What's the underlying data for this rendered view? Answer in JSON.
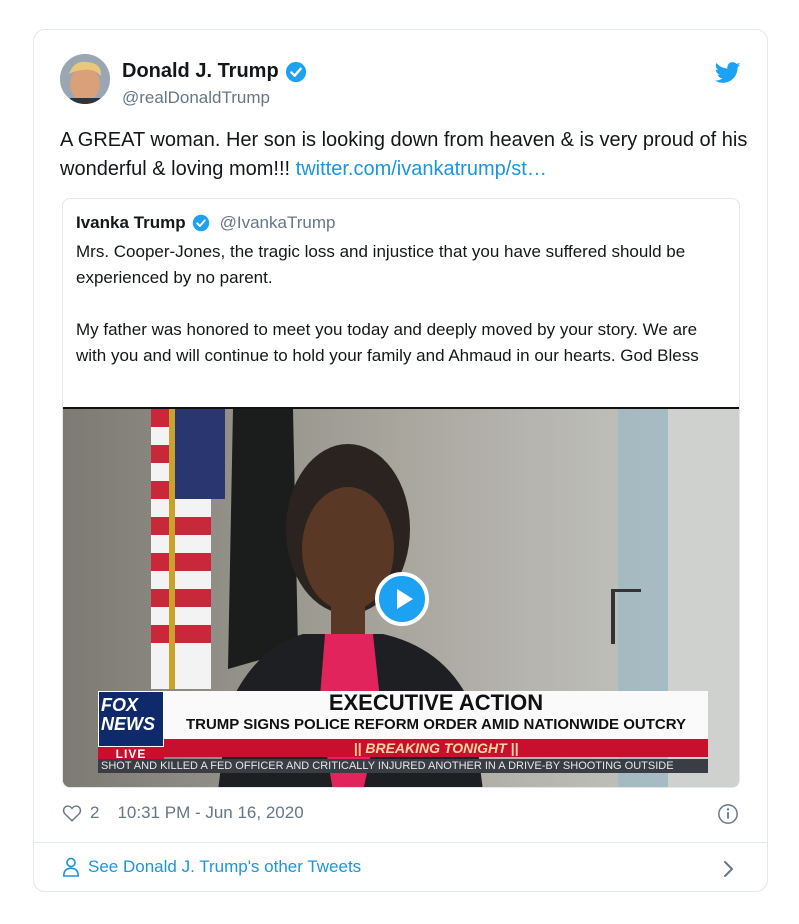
{
  "tweet": {
    "author_name": "Donald J. Trump",
    "author_handle": "@realDonaldTrump",
    "text": "A GREAT woman. Her son is looking down from heaven & is very proud of his wonderful & loving mom!!! ",
    "link_text": "twitter.com/ivankatrump/st…",
    "likes": "2",
    "timestamp": "10:31 PM - Jun 16, 2020"
  },
  "quoted_tweet": {
    "author_name": "Ivanka Trump",
    "author_handle": "@IvankaTrump",
    "paragraph_1": "Mrs. Cooper-Jones, the tragic loss and injustice that you have suffered should be experienced by no parent.",
    "paragraph_2": "My father was honored to meet you today and deeply moved by your story. We are with you and will continue to hold your family and Ahmaud in our hearts. God Bless"
  },
  "video": {
    "network_logo_line1": "FOX",
    "network_logo_line2": "NEWS",
    "live_label": "LIVE",
    "chyron_title": "EXECUTIVE ACTION",
    "chyron_subtitle": "TRUMP SIGNS POLICE REFORM ORDER AMID NATIONWIDE OUTCRY",
    "breaking_label": "|| BREAKING TONIGHT ||",
    "ticker_text": "SHOT AND KILLED A FED OFFICER AND CRITICALLY INJURED ANOTHER IN A DRIVE-BY SHOOTING OUTSIDE"
  },
  "footer": {
    "other_tweets_label": "See Donald J. Trump's other Tweets"
  },
  "colors": {
    "link": "#1b95e0",
    "verified": "#1da1f2",
    "muted": "#657786",
    "border": "#e1e8ed"
  },
  "icons": [
    "verified-badge-icon",
    "twitter-bird-icon",
    "play-icon",
    "heart-icon",
    "info-icon",
    "person-icon",
    "chevron-right-icon"
  ]
}
